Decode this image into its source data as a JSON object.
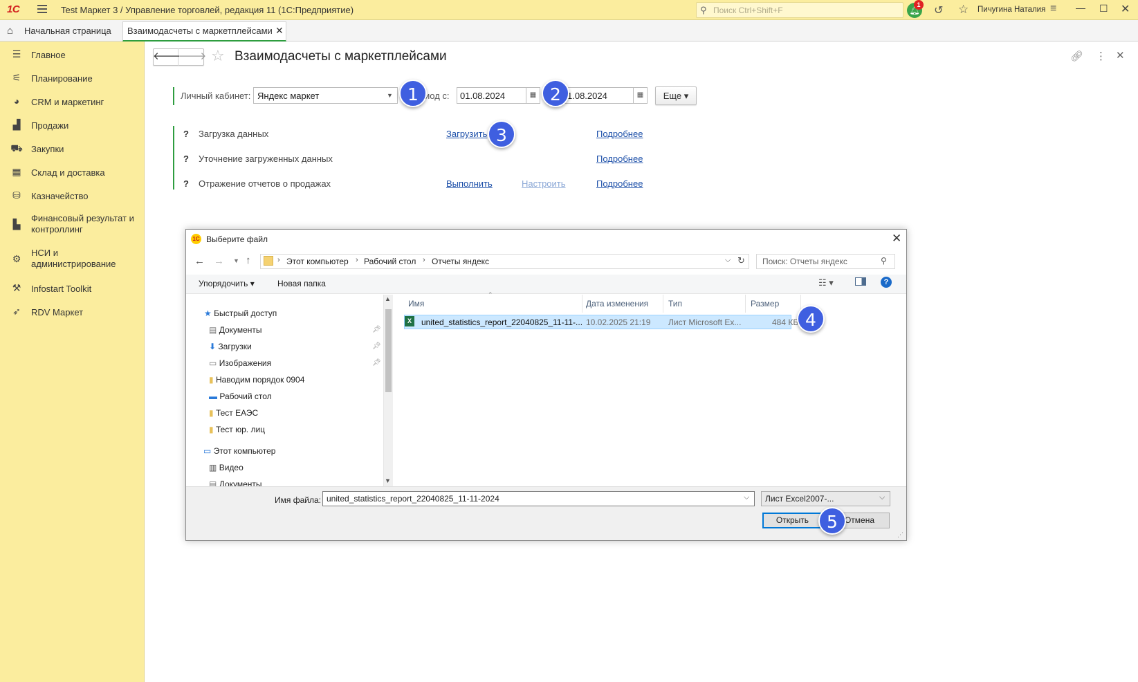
{
  "app": {
    "title": "Test Маркет 3 / Управление торговлей, редакция 11  (1С:Предприятие)",
    "logo": "1С",
    "search_placeholder": "Поиск Ctrl+Shift+F",
    "notifications_count": "1",
    "user_name": "Пичугина Наталия"
  },
  "tabs": {
    "home": "Начальная страница",
    "active": "Взаимодасчеты с маркетплейсами"
  },
  "sidebar": {
    "items": [
      {
        "label": "Главное",
        "icon": "menu-icon"
      },
      {
        "label": "Планирование",
        "icon": "planning-icon"
      },
      {
        "label": "CRM и маркетинг",
        "icon": "pie-chart-icon"
      },
      {
        "label": "Продажи",
        "icon": "bag-icon"
      },
      {
        "label": "Закупки",
        "icon": "cart-icon"
      },
      {
        "label": "Склад и доставка",
        "icon": "grid-icon"
      },
      {
        "label": "Казначейство",
        "icon": "coins-icon"
      },
      {
        "label": "Финансовый результат и контроллинг",
        "icon": "bar-chart-icon"
      },
      {
        "label": "НСИ и администрирование",
        "icon": "gear-icon"
      },
      {
        "label": "Infostart Toolkit",
        "icon": "tools-icon"
      },
      {
        "label": "RDV Маркет",
        "icon": "rocket-icon"
      }
    ]
  },
  "form": {
    "title": "Взаимодасчеты с маркетплейсами",
    "cabinet_label": "Личный кабинет:",
    "cabinet_value": "Яндекс маркет",
    "period_label": "иод с:",
    "date_from": "01.08.2024",
    "date_to": "1.08.2024",
    "more_button": "Еще ▾",
    "actions": [
      {
        "q": "?",
        "label": "Загрузка данных",
        "action": "Загрузить",
        "details": "Подробнее"
      },
      {
        "q": "?",
        "label": "Уточнение загруженных данных",
        "details": "Подробнее"
      },
      {
        "q": "?",
        "label": "Отражение отчетов о продажах",
        "action": "Выполнить",
        "setup": "Настроить",
        "details": "Подробнее"
      }
    ]
  },
  "markers": [
    "1",
    "2",
    "3",
    "4",
    "5"
  ],
  "dialog": {
    "title": "Выберите файл",
    "breadcrumbs": [
      "Этот компьютер",
      "Рабочий стол",
      "Отчеты яндекс"
    ],
    "search_placeholder": "Поиск: Отчеты яндекс",
    "organize": "Упорядочить ▾",
    "new_folder": "Новая папка",
    "tree": [
      {
        "label": "Быстрый доступ"
      },
      {
        "label": "Документы"
      },
      {
        "label": "Загрузки"
      },
      {
        "label": "Изображения"
      },
      {
        "label": "Наводим порядок 0904"
      },
      {
        "label": "Рабочий стол"
      },
      {
        "label": "Тест ЕАЭС"
      },
      {
        "label": "Тест юр. лиц"
      },
      {
        "label": "Этот компьютер"
      },
      {
        "label": "Видео"
      },
      {
        "label": "Документы"
      }
    ],
    "columns": [
      "Имя",
      "Дата изменения",
      "Тип",
      "Размер"
    ],
    "files": [
      {
        "name": "united_statistics_report_22040825_11-11-...",
        "modified": "10.02.2025 21:19",
        "type": "Лист Microsoft Ex...",
        "size": "484 КБ"
      }
    ],
    "filename_label": "Имя файла:",
    "filename_value": "united_statistics_report_22040825_11-11-2024",
    "filetype": "Лист Excel2007-...",
    "open_button": "Открыть",
    "cancel_button": "Отмена"
  }
}
